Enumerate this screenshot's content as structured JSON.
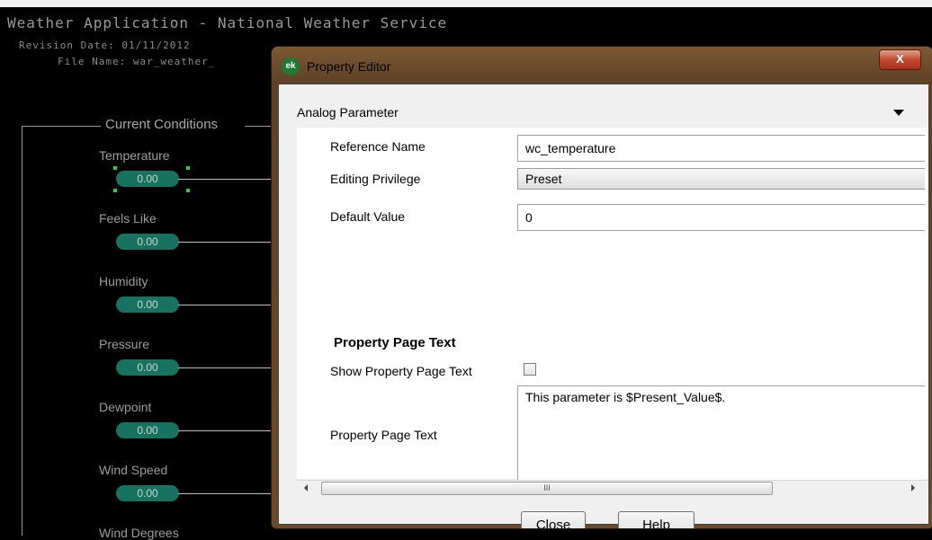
{
  "app": {
    "title": "Weather Application - National Weather Service",
    "revision": "Revision Date: 01/11/2012",
    "file_name": "File Name: war_weather_"
  },
  "conditions": {
    "title": "Current Conditions",
    "items": [
      {
        "label": "Temperature",
        "value": "0.00"
      },
      {
        "label": "Feels Like",
        "value": "0.00"
      },
      {
        "label": "Humidity",
        "value": "0.00"
      },
      {
        "label": "Pressure",
        "value": "0.00"
      },
      {
        "label": "Dewpoint",
        "value": "0.00"
      },
      {
        "label": "Wind Speed",
        "value": "0.00"
      },
      {
        "label": "Wind Degrees",
        "value": ""
      }
    ]
  },
  "dialog": {
    "title": "Property Editor",
    "icon_text": "ek",
    "close_glyph": "X",
    "dropdown_label": "Analog Parameter",
    "fields": {
      "reference_name_label": "Reference Name",
      "reference_name_value": "wc_temperature",
      "editing_privilege_label": "Editing Privilege",
      "editing_privilege_value": "Preset",
      "default_value_label": "Default Value",
      "default_value_value": "0",
      "section_heading": "Property Page Text",
      "show_text_label": "Show Property Page Text",
      "show_text_checked": false,
      "page_text_label": "Property Page Text",
      "page_text_value": "This parameter is $Present_Value$."
    },
    "scroll_grip": "III",
    "buttons": {
      "close": "Close",
      "help": "Help"
    }
  },
  "colors": {
    "background": "#000000",
    "pill": "#17725f",
    "frame": "#6b4a2b",
    "close_button": "#c24a2f"
  },
  "icons": [
    "ek-app-icon",
    "close-icon",
    "chevron-down-icon",
    "scroll-left-icon",
    "scroll-right-icon"
  ]
}
